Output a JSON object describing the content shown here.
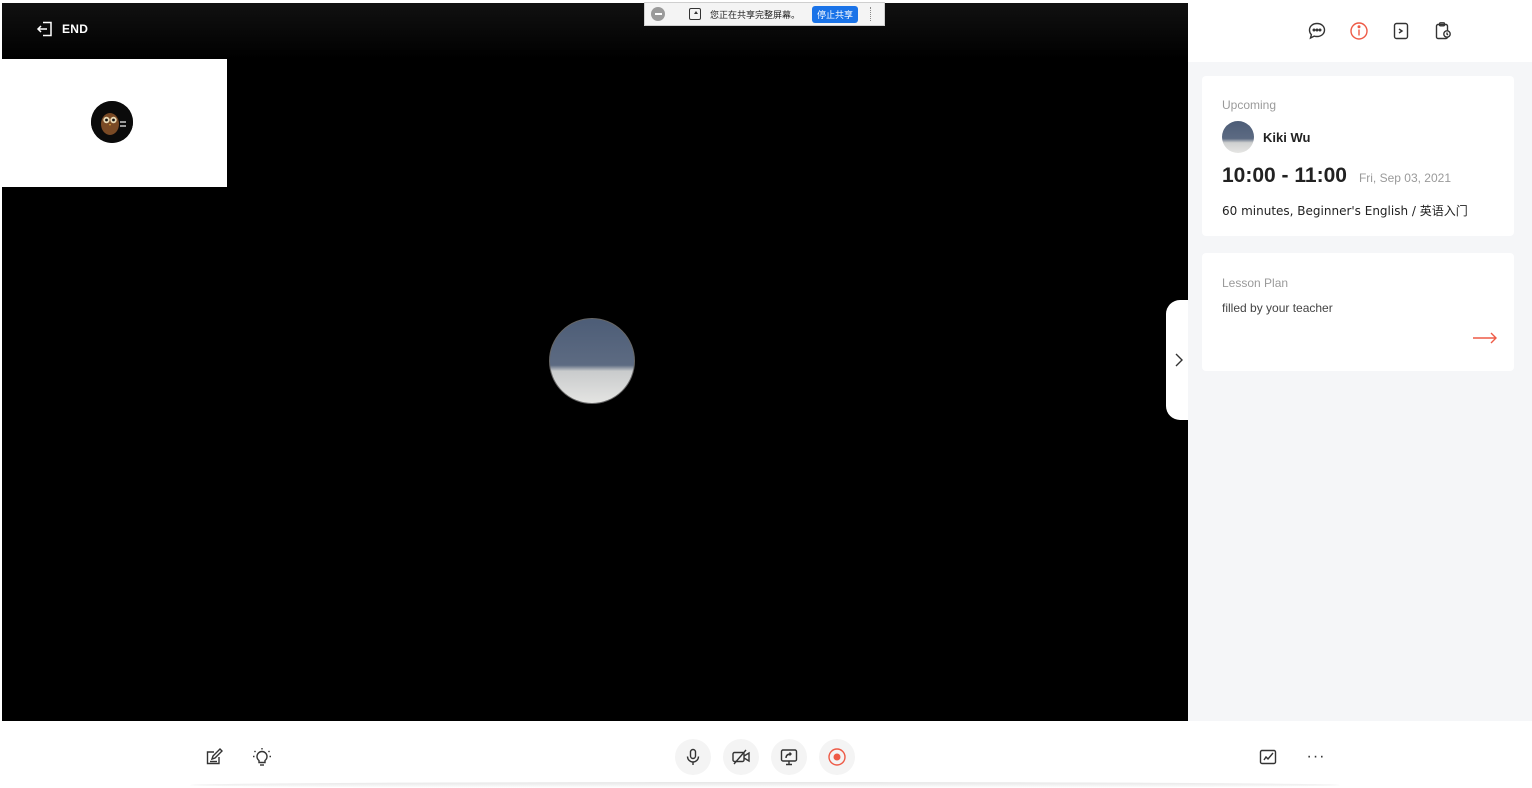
{
  "header": {
    "end_label": "END"
  },
  "screen_share": {
    "message": "您正在共享完整屏幕。",
    "stop_label": "停止共享"
  },
  "sidebar": {
    "tabs": [
      "chat-icon",
      "info-icon",
      "notes-icon",
      "homework-icon"
    ],
    "active_tab": "info-icon",
    "upcoming": {
      "label": "Upcoming",
      "teacher_name": "Kiki Wu",
      "time_range": "10:00 - 11:00",
      "date": "Fri, Sep 03, 2021",
      "description": "60 minutes, Beginner's English / 英语入门"
    },
    "lesson_plan": {
      "label": "Lesson Plan",
      "note": "filled by your teacher"
    }
  },
  "toolbar": {
    "left_tools": [
      "edit-note-icon",
      "lightbulb-icon"
    ],
    "center_controls": [
      "microphone-icon",
      "camera-off-icon",
      "screen-share-icon",
      "record-icon"
    ],
    "right_tools": [
      "signature-icon",
      "more-icon"
    ],
    "more_label": "···"
  },
  "colors": {
    "accent": "#ee5a46",
    "share_blue": "#1a73e8",
    "stage": "#000000",
    "sidebar_bg": "#f5f6f8"
  }
}
